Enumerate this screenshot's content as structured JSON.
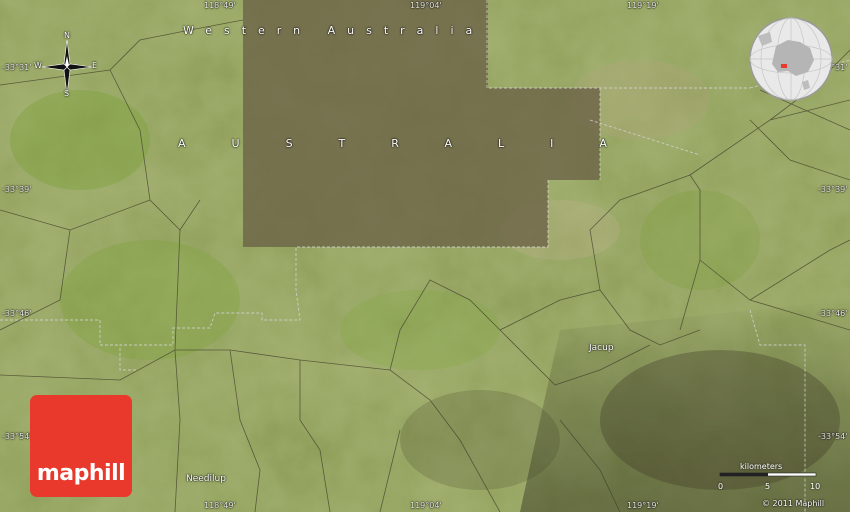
{
  "map": {
    "region_label": "Western Australia",
    "country_label": "AUSTRALIA",
    "places": [
      {
        "name": "Jacup"
      },
      {
        "name": "Needilup"
      }
    ],
    "top_coords": [
      "118°49'",
      "119°04'",
      "119°19'"
    ],
    "bottom_coords": [
      "118°49'",
      "119°04'",
      "119°19'"
    ],
    "left_coords": [
      "-33°31'",
      "-33°39'",
      "-33°46'",
      "-33°54'"
    ],
    "right_coords": [
      "-33°31'",
      "-33°39'",
      "-33°46'",
      "-33°54'"
    ]
  },
  "compass": {
    "n": "N",
    "s": "S",
    "e": "E",
    "w": "W"
  },
  "logo": {
    "text": "maphill"
  },
  "scale": {
    "title": "kilometers",
    "ticks": [
      "0",
      "5",
      "10"
    ]
  },
  "copyright": "© 2011 Maphill",
  "colors": {
    "logo_red": "#e8392c",
    "land": "#7d8a4a",
    "dark_block": "#6f6548"
  }
}
